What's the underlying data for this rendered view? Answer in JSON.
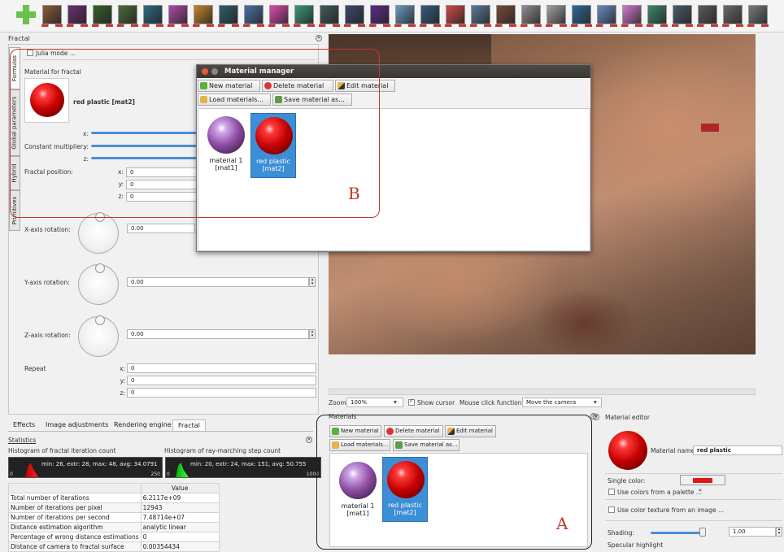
{
  "thumbnails": [
    "#8c5a3a",
    "#6b2f6e",
    "#395f2c",
    "#4a6a3a",
    "#2f6a80",
    "#b04aa8",
    "#c2842f",
    "#2e5e6b",
    "#4a72a8",
    "#e04ab0",
    "#3a9a7a",
    "#425a5a",
    "#3a4a6a",
    "#5e2a8a",
    "#6a9ac0",
    "#375a7a",
    "#d04a4a",
    "#5a7a9a",
    "#7a4a3a",
    "#909090",
    "#a0a0a0",
    "#2e6a9a",
    "#6a8ac0",
    "#d27ad0",
    "#3a8a6a",
    "#4a5a6a",
    "#5a5a5a",
    "#6a6a6a",
    "#7a7a7a"
  ],
  "fractal_panel": {
    "title": "Fractal",
    "vtabs": [
      "Formulas",
      "Global parameters",
      "Hybrid",
      "Primitives"
    ],
    "julia_mode": "Julia mode ...",
    "material_section": "Material for fractal",
    "material_name": "red plastic [mat2]",
    "constant_multiplier": "Constant multiplier:",
    "axes": [
      "x:",
      "y:",
      "z:"
    ],
    "fractal_position_label": "Fractal position:",
    "fractal_position": [
      "0",
      "0",
      "0"
    ],
    "x_rotation_label": "X-axis rotation:",
    "x_rotation": "0.00",
    "y_rotation_label": "Y-axis rotation:",
    "y_rotation": "0.00",
    "z_rotation_label": "Z-axis rotation:",
    "z_rotation": "0.00",
    "repeat_label": "Repeat",
    "repeat": [
      "0",
      "0",
      "0"
    ]
  },
  "material_manager": {
    "title": "Material manager",
    "new": "New material",
    "delete": "Delete material",
    "edit": "Edit material",
    "load": "Load materials...",
    "save": "Save material as...",
    "items": [
      {
        "line1": "material 1",
        "line2": "[mat1]"
      },
      {
        "line1": "red plastic",
        "line2": "[mat2]"
      }
    ]
  },
  "annotations": {
    "a": "A",
    "b": "B"
  },
  "viewport": {
    "zoom_label": "Zoom:",
    "zoom_value": "100%",
    "show_cursor": "Show cursor",
    "mouse_click_label": "Mouse click function:",
    "mouse_click_value": "Move the camera"
  },
  "bottom_tabs": [
    "Effects",
    "Image adjustments",
    "Rendering engine",
    "Fractal"
  ],
  "statistics": {
    "title": "Statistics",
    "hist1_title": "Histogram of fractal iteration count",
    "hist1_text": "min: 26, extr: 28, max: 48, avg: 34.0791",
    "hist1_start": "0",
    "hist1_end": "250",
    "hist2_title": "Histogram of ray-marching step count",
    "hist2_text": "min: 20, extr: 24, max: 151, avg: 50.755",
    "hist2_start": "0",
    "hist2_end": "1000",
    "value_header": "Value",
    "rows": [
      [
        "Total number of iterations",
        "6.2117e+09"
      ],
      [
        "Number of iterations per pixel",
        "12943"
      ],
      [
        "Number of iterations per second",
        "7.48714e+07"
      ],
      [
        "Distance estimation algorithm",
        "analytic linear"
      ],
      [
        "Percentage of wrong distance estimations",
        "0"
      ],
      [
        "Distance of camera to fractal surface",
        "0.00354434"
      ]
    ]
  },
  "materials_dock": {
    "title": "Materials",
    "new": "New material",
    "delete": "Delete material",
    "edit": "Edit material",
    "load": "Load materials...",
    "save": "Save material as...",
    "items": [
      {
        "line1": "material 1",
        "line2": "[mat1]"
      },
      {
        "line1": "red plastic",
        "line2": "[mat2]"
      }
    ]
  },
  "material_editor": {
    "title": "Material editor",
    "name_label": "Material name:",
    "name_value": "red plastic",
    "single_color": "Single color:",
    "single_color_hex": "#e01818",
    "palette": "Use colors from a palette ...",
    "palette_mark": "*",
    "texture": "Use color texture from an image ...",
    "shading": "Shading:",
    "shading_value": "1.00",
    "specular": "Specular highlight"
  }
}
